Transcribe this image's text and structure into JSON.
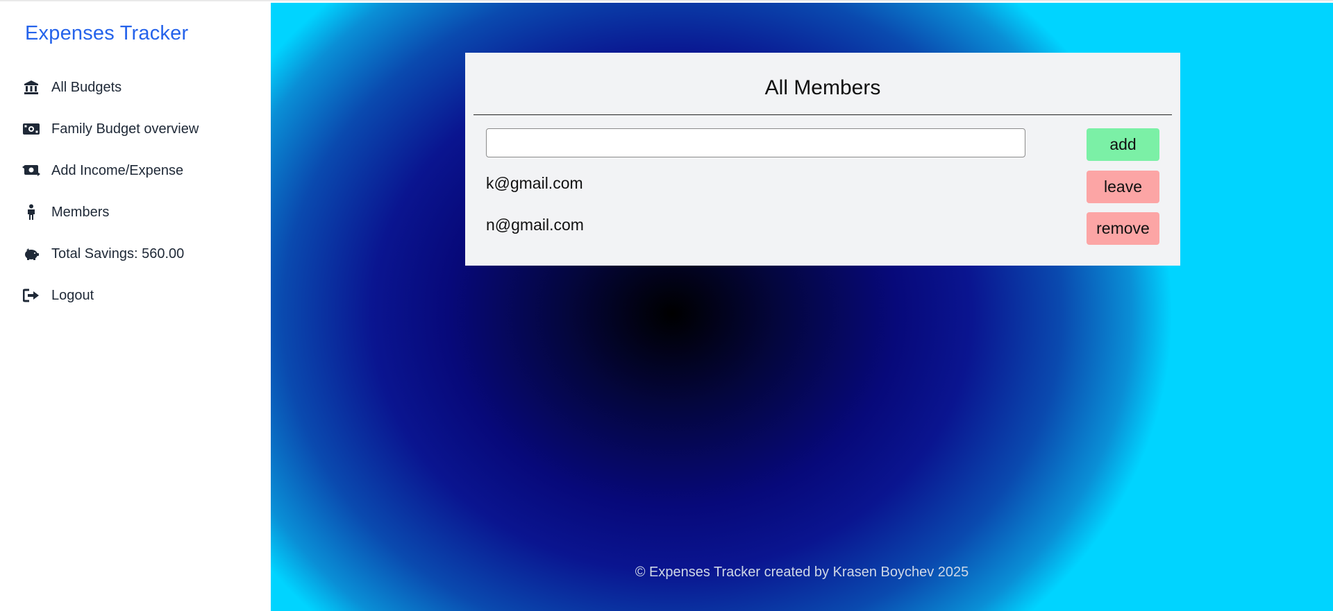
{
  "sidebar": {
    "brand": "Expenses Tracker",
    "items": [
      {
        "label": "All Budgets",
        "icon": "bank-icon"
      },
      {
        "label": "Family Budget overview",
        "icon": "money-bill-icon"
      },
      {
        "label": "Add Income/Expense",
        "icon": "money-exchange-icon"
      },
      {
        "label": "Members",
        "icon": "person-icon"
      },
      {
        "label": "Total Savings: 560.00",
        "icon": "piggy-bank-icon"
      },
      {
        "label": "Logout",
        "icon": "logout-icon"
      }
    ]
  },
  "members_card": {
    "title": "All Members",
    "input_value": "",
    "add_label": "add",
    "members": [
      {
        "email": "k@gmail.com",
        "action": "leave"
      },
      {
        "email": "n@gmail.com",
        "action": "remove"
      }
    ]
  },
  "footer": {
    "text": "© Expenses Tracker created by Krasen Boychev 2025"
  },
  "colors": {
    "brand": "#2563eb",
    "add_button": "#7bf0a6",
    "danger_button": "#fca5a5",
    "card_bg": "#f2f3f5"
  }
}
